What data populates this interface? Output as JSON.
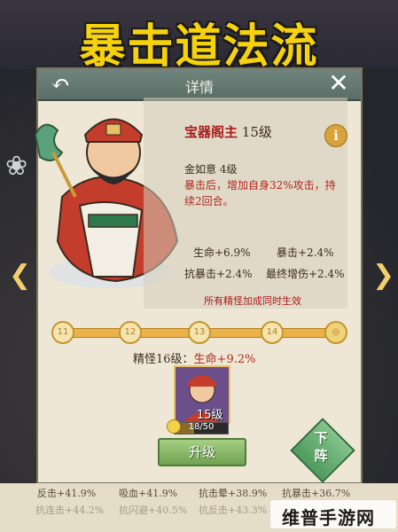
{
  "banner": {
    "title": "暴击道法流"
  },
  "panel": {
    "title": "详情"
  },
  "hero": {
    "name": "宝器阁主",
    "level": "15级",
    "skill_name": "金如意 4级",
    "skill_desc": "暴击后，增加自身32%攻击，持续2回合。"
  },
  "stats": {
    "hp": "生命+6.9%",
    "crit": "暴击+2.4%",
    "crit_res": "抗暴击+2.4%",
    "final_dmg": "最终增伤+2.4%",
    "note": "所有精怪加成同时生效"
  },
  "track": {
    "nodes": [
      "11",
      "12",
      "13",
      "14"
    ],
    "end_icon": "swirl-icon"
  },
  "progress": {
    "label": "精怪16级：",
    "value": "生命+9.2%"
  },
  "portrait": {
    "level": "15级",
    "fragments": "18/50",
    "fragment_fraction": 0.36
  },
  "buttons": {
    "upgrade": "升级",
    "down_label": "下阵"
  },
  "bottom": {
    "row1": [
      "反击+41.9%",
      "吸血+41.9%",
      "抗击晕+38.9%",
      "抗暴击+36.7%"
    ],
    "row2": [
      "抗连击+44.2%",
      "抗闪避+40.5%",
      "抗反击+43.3%",
      ""
    ]
  },
  "watermark": {
    "text": "维普手游网"
  },
  "colors": {
    "banner_text": "#f6d20d",
    "accent_red": "#b0281f",
    "button_green": "#6fa352"
  }
}
